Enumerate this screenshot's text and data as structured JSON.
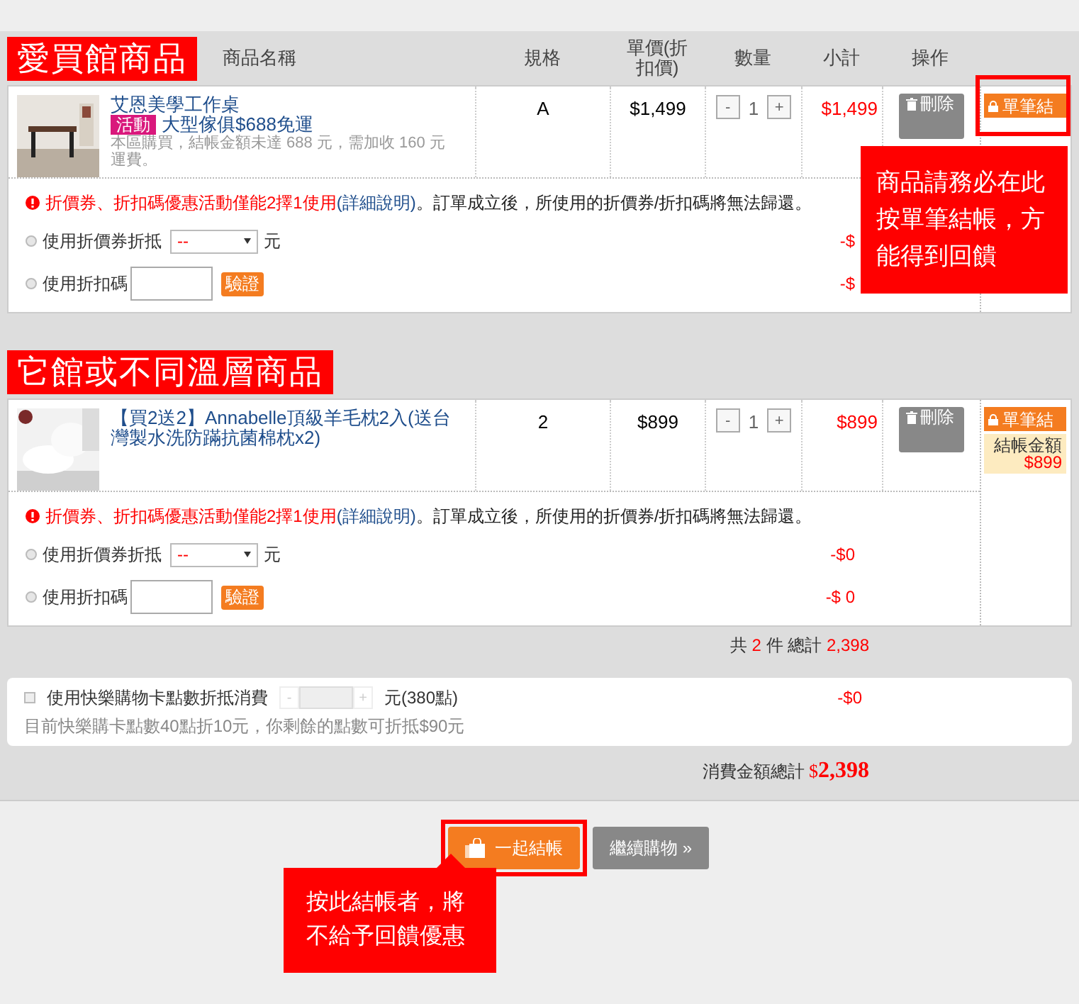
{
  "columns": [
    "商品名稱",
    "規格",
    "單價(折扣價)",
    "數量",
    "小計",
    "操作"
  ],
  "stores": [
    {
      "title": "愛買館商品",
      "show_columns": true,
      "products": [
        {
          "name": "艾恩美學工作桌",
          "promo_tag": "活動",
          "promo_text": "大型傢俱$688免運",
          "shipping_note": "本區購買，結帳金額未達 688 元，需加收 160 元運費。",
          "spec": "A",
          "price": "$1,499",
          "minus": "-",
          "qty": "1",
          "plus": "+",
          "subtotal": "$1,499",
          "delete_label": "刪除"
        }
      ],
      "notice": {
        "warning": "折價券、折扣碼優惠活動僅能2擇1使用",
        "link": "(詳細說明)",
        "rest": "。訂單成立後，所使用的折價券/折扣碼將無法歸還。"
      },
      "coupon": {
        "label": "使用折價券折抵",
        "select": "--",
        "unit": "元",
        "amount": "-$",
        "selected": false
      },
      "code": {
        "label": "使用折扣碼",
        "verify": "驗證",
        "amount": "-$",
        "selected": false
      },
      "checkout": {
        "label": "單筆結"
      }
    },
    {
      "title": "它館或不同溫層商品",
      "show_columns": false,
      "products": [
        {
          "name": "【買2送2】Annabelle頂級羊毛枕2入(送台灣製水洗防蹣抗菌棉枕x2)",
          "spec": "2",
          "price": "$899",
          "minus": "-",
          "qty": "1",
          "plus": "+",
          "subtotal": "$899",
          "delete_label": "刪除"
        }
      ],
      "notice": {
        "warning": "折價券、折扣碼優惠活動僅能2擇1使用",
        "link": "(詳細說明)",
        "rest": "。訂單成立後，所使用的折價券/折扣碼將無法歸還。"
      },
      "coupon": {
        "label": "使用折價券折抵",
        "select": "--",
        "unit": "元",
        "amount": "-$0",
        "selected": false
      },
      "code": {
        "label": "使用折扣碼",
        "verify": "驗證",
        "amount": "-$ 0",
        "selected": false
      },
      "checkout": {
        "label": "單筆結",
        "amount_label": "結帳金額",
        "amount": "$899"
      }
    }
  ],
  "summary": {
    "prefix": "共",
    "count": "2",
    "middle": "件 總計",
    "total": "2,398"
  },
  "points": {
    "checked": false,
    "label": "使用快樂購物卡點數折抵消費",
    "minus": "-",
    "plus": "+",
    "unit": "元(380點)",
    "amount": "-$0",
    "note": "目前快樂購卡點數40點折10元，你剩餘的點數可折抵$90元"
  },
  "grand_total": {
    "label": "消費金額總計",
    "currency": "$",
    "amount": "2,398"
  },
  "buttons": [
    {
      "kind": "primary",
      "label": "一起結帳"
    },
    {
      "kind": "secondary",
      "label": "繼續購物 »"
    }
  ],
  "callouts": [
    {
      "text": "商品請務必在此按單筆結帳，方能得到回饋"
    },
    {
      "text": "按此結帳者，將不給予回饋優惠"
    }
  ]
}
